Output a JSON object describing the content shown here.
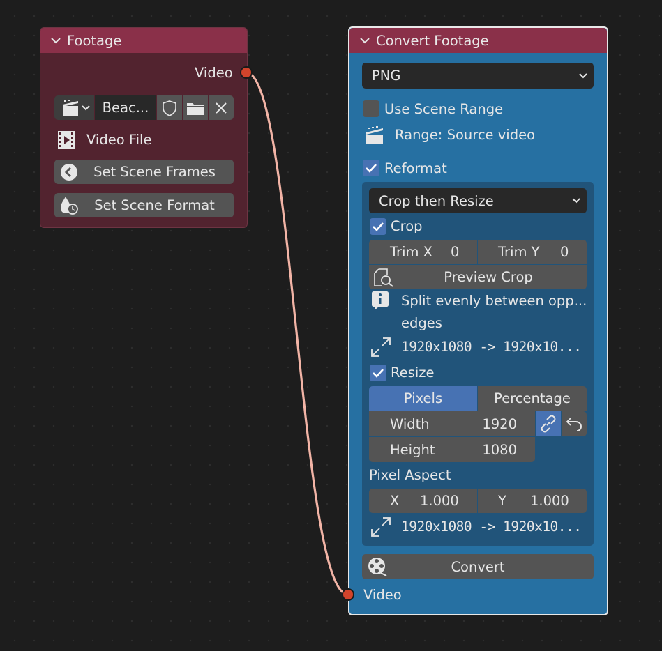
{
  "footage_node": {
    "title": "Footage",
    "output_socket": "Video",
    "clip_name": "Beac...",
    "file_label": "Video File",
    "set_frames": "Set Scene Frames",
    "set_format": "Set Scene Format"
  },
  "convert_node": {
    "title": "Convert Footage",
    "format": "PNG",
    "use_scene_range": "Use Scene Range",
    "range_info": "Range: Source video",
    "reformat": "Reformat",
    "reformat_mode": "Crop then Resize",
    "crop": "Crop",
    "trim_x_label": "Trim X",
    "trim_x_value": "0",
    "trim_y_label": "Trim Y",
    "trim_y_value": "0",
    "preview_crop": "Preview Crop",
    "info_line1": "Split evenly between opp...",
    "info_line2": "edges",
    "crop_dims": "1920x1080  ->  1920x10...",
    "resize": "Resize",
    "unit_pixels": "Pixels",
    "unit_percentage": "Percentage",
    "width_label": "Width",
    "width_value": "1920",
    "height_label": "Height",
    "height_value": "1080",
    "pixel_aspect": "Pixel Aspect",
    "aspect_x_label": "X",
    "aspect_x_value": "1.000",
    "aspect_y_label": "Y",
    "aspect_y_value": "1.000",
    "final_dims": "1920x1080  ->  1920x10...",
    "convert_button": "Convert",
    "input_socket": "Video"
  },
  "colors": {
    "footage_body": "#52232f",
    "node_header": "#8a3049",
    "convert_body": "#2670a2",
    "socket_video": "#d2442c",
    "link": "#f2b4a6",
    "accent": "#4772b3"
  }
}
